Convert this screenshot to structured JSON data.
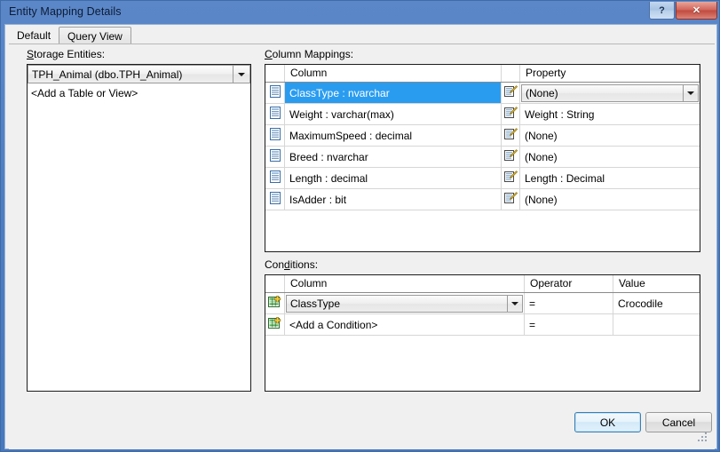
{
  "window": {
    "title": "Entity Mapping Details",
    "help_label": "?",
    "close_label": "✕"
  },
  "tabs": [
    {
      "label": "Default",
      "active": true
    },
    {
      "label": "Query View",
      "active": false
    }
  ],
  "storage": {
    "label_prefix": "",
    "label_accel": "S",
    "label_rest": "torage Entities:",
    "selected_entity": "TPH_Animal (dbo.TPH_Animal)",
    "add_item": "<Add a Table or View>"
  },
  "column_mappings": {
    "label_accel": "C",
    "label_rest": "olumn Mappings:",
    "headers": [
      "",
      "Column",
      "",
      "Property"
    ],
    "rows": [
      {
        "column": "ClassType : nvarchar",
        "property": "(None)",
        "selected": true,
        "property_is_combo": true
      },
      {
        "column": "Weight : varchar(max)",
        "property": "Weight : String",
        "selected": false,
        "property_is_combo": false
      },
      {
        "column": "MaximumSpeed : decimal",
        "property": "(None)",
        "selected": false,
        "property_is_combo": false
      },
      {
        "column": "Breed : nvarchar",
        "property": "(None)",
        "selected": false,
        "property_is_combo": false
      },
      {
        "column": "Length : decimal",
        "property": "Length : Decimal",
        "selected": false,
        "property_is_combo": false
      },
      {
        "column": "IsAdder : bit",
        "property": "(None)",
        "selected": false,
        "property_is_combo": false
      }
    ]
  },
  "conditions": {
    "label_pre": "Con",
    "label_accel": "d",
    "label_rest": "itions:",
    "headers": [
      "",
      "Column",
      "Operator",
      "Value"
    ],
    "rows": [
      {
        "column": "ClassType",
        "operator": "=",
        "value": "Crocodile",
        "column_is_combo": true
      },
      {
        "column": "<Add a Condition>",
        "operator": "=",
        "value": "",
        "column_is_combo": false
      }
    ]
  },
  "footer": {
    "ok_label": "OK",
    "cancel_label": "Cancel"
  },
  "colors": {
    "titlebar": "#4f7ec0",
    "selection": "#2a9cf0",
    "close_button": "#c04a3e",
    "default_button_border": "#3c7fb1"
  }
}
